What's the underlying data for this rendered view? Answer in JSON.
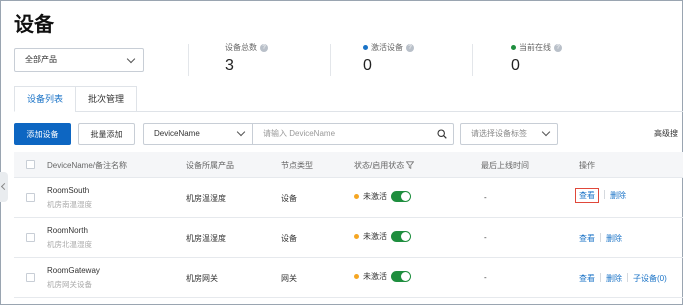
{
  "page": {
    "title": "设备"
  },
  "product_filter": {
    "selected": "全部产品"
  },
  "stats": [
    {
      "label": "设备总数",
      "value": "3",
      "dot_color": ""
    },
    {
      "label": "激活设备",
      "value": "0",
      "dot_color": "#1a73c7"
    },
    {
      "label": "当前在线",
      "value": "0",
      "dot_color": "#1e8e3e"
    }
  ],
  "tabs": [
    {
      "label": "设备列表",
      "active": true
    },
    {
      "label": "批次管理",
      "active": false
    }
  ],
  "toolbar": {
    "add_device": "添加设备",
    "batch_add": "批量添加",
    "search_field": "DeviceName",
    "search_placeholder": "请输入 DeviceName",
    "tag_placeholder": "请选择设备标签",
    "advanced": "高级搜"
  },
  "table": {
    "headers": {
      "name": "DeviceName/备注名称",
      "product": "设备所属产品",
      "node_type": "节点类型",
      "status": "状态/启用状态",
      "last_online": "最后上线时间",
      "actions": "操作"
    },
    "rows": [
      {
        "name": "RoomSouth",
        "note": "机房南温湿度",
        "product": "机房温湿度",
        "node_type": "设备",
        "status": "未激活",
        "last_online": "-",
        "view": "查看",
        "delete": "删除",
        "sub": ""
      },
      {
        "name": "RoomNorth",
        "note": "机房北温湿度",
        "product": "机房温湿度",
        "node_type": "设备",
        "status": "未激活",
        "last_online": "-",
        "view": "查看",
        "delete": "删除",
        "sub": ""
      },
      {
        "name": "RoomGateway",
        "note": "机房网关设备",
        "product": "机房网关",
        "node_type": "网关",
        "status": "未激活",
        "last_online": "-",
        "view": "查看",
        "delete": "删除",
        "sub": "子设备(0)"
      }
    ]
  },
  "colors": {
    "primary": "#0d66c2",
    "link": "#1a73c7",
    "status_inactive": "#f5a623",
    "toggle_on": "#1e8e3e",
    "highlight": "#e0483a"
  }
}
